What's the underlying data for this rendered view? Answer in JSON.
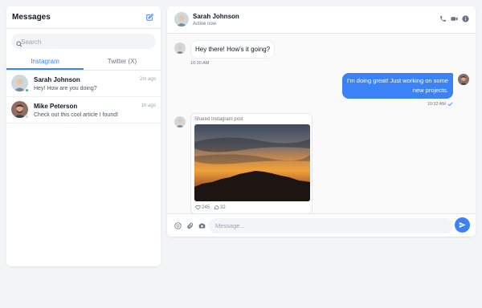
{
  "sidebar": {
    "title": "Messages",
    "search_placeholder": "Search",
    "tabs": [
      {
        "label": "Instagram",
        "active": true
      },
      {
        "label": "Twitter (X)",
        "active": false
      }
    ],
    "conversations": [
      {
        "name": "Sarah Johnson",
        "preview": "Hey! How are you doing?",
        "time": "2m ago",
        "online": true
      },
      {
        "name": "Mike Peterson",
        "preview": "Check out this cool article I found!",
        "time": "1h ago",
        "online": false
      }
    ]
  },
  "chat": {
    "contact_name": "Sarah Johnson",
    "contact_status": "Active now",
    "header_icons": [
      "phone-icon",
      "video-icon",
      "info-icon"
    ],
    "messages": [
      {
        "direction": "in",
        "text": "Hey there! How's it going?",
        "time": "10:30 AM"
      },
      {
        "direction": "out",
        "text_line1": "I'm doing great! Just working on some",
        "text_line2": "new projects.",
        "time": "10:32 AM",
        "read": true
      },
      {
        "direction": "in",
        "type": "shared_post",
        "label": "Shared Instagram post",
        "likes": "245",
        "comments": "32"
      }
    ],
    "composer": {
      "placeholder": "Message...",
      "icons": [
        "emoji-icon",
        "paperclip-icon",
        "camera-icon"
      ],
      "send_icon": "send-icon"
    }
  },
  "colors": {
    "accent": "#3b82f6",
    "online": "#22c55e",
    "background": "#f3f4f6"
  }
}
